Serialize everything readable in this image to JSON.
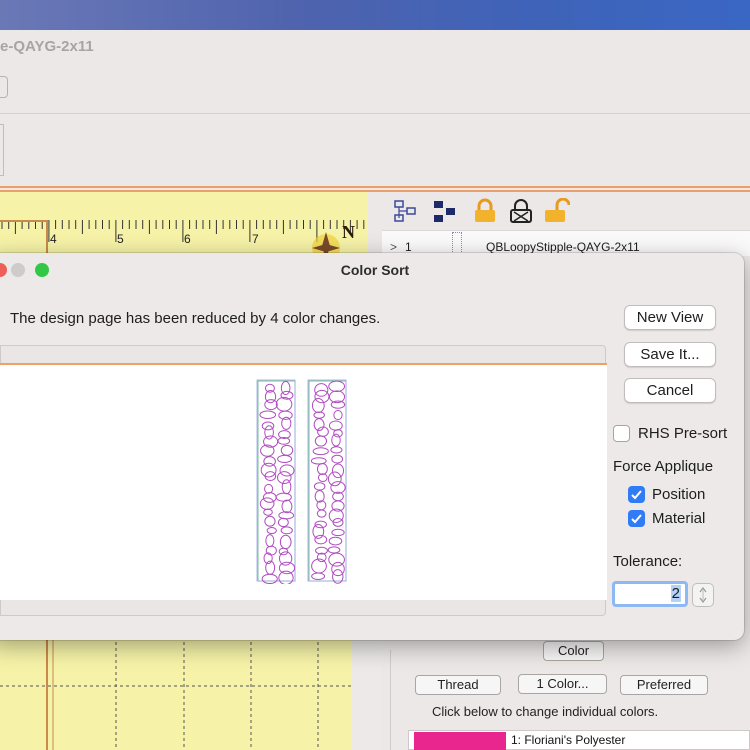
{
  "app": {
    "title": "e-QAYG-2x11",
    "ruler_labels": [
      "4",
      "5",
      "6",
      "7"
    ],
    "compass_letter": "N",
    "layer": {
      "number": "1",
      "name": "QBLoopyStipple-QAYG-2x11"
    }
  },
  "dialog": {
    "title": "Color Sort",
    "message": "The design page has been reduced by 4 color changes.",
    "buttons": {
      "new_view": "New View",
      "save": "Save It...",
      "cancel": "Cancel"
    },
    "rhs_presort": {
      "label": "RHS Pre-sort",
      "checked": false
    },
    "force_applique": {
      "label": "Force Applique",
      "position": {
        "label": "Position",
        "checked": true
      },
      "material": {
        "label": "Material",
        "checked": true
      }
    },
    "tolerance": {
      "label": "Tolerance:",
      "value": "2"
    }
  },
  "color_panel": {
    "color_button": "Color",
    "thread_button": "Thread",
    "one_color_button": "1 Color...",
    "preferred_button": "Preferred",
    "hint": "Click below to change individual colors.",
    "colors": [
      {
        "name": "1: Floriani's Polyester",
        "swatch": "#e8268e"
      }
    ]
  },
  "colors": {
    "accent_blue": "#2f7cf6",
    "traffic_close": "#ee5f57",
    "traffic_min": "#cfcbca",
    "traffic_max": "#33c748",
    "ruler_yellow": "#f6f3a8",
    "stitch_purple": "#b04cc0"
  }
}
